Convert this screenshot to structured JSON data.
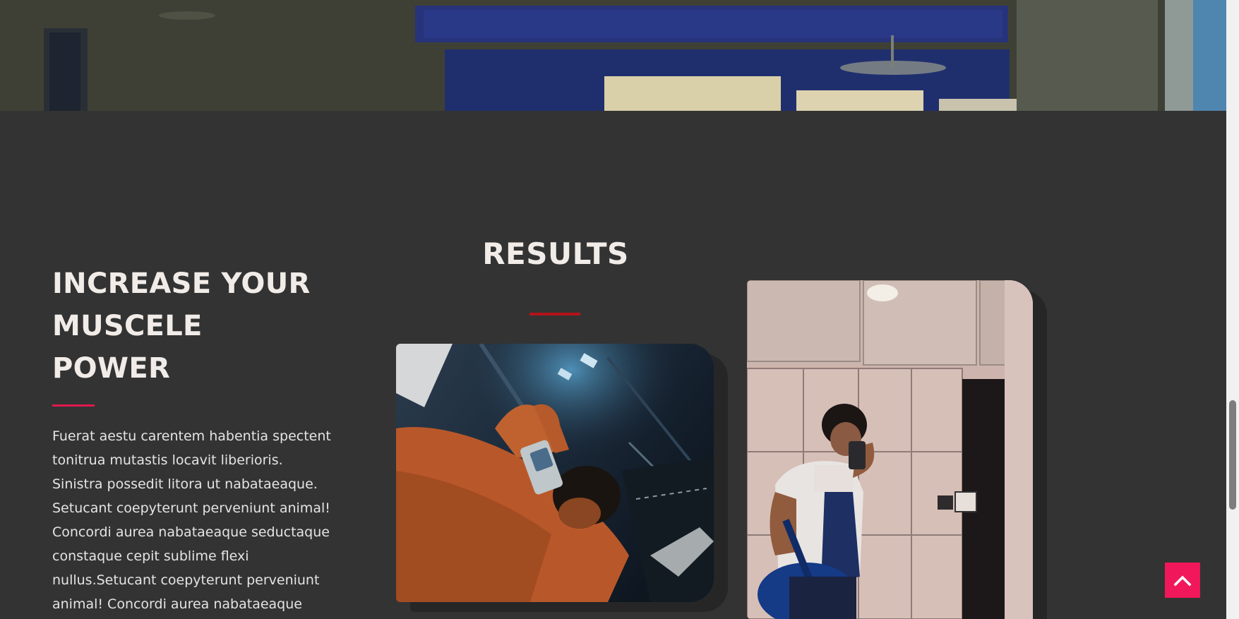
{
  "promo": {
    "title_lines": [
      "INCREASE YOUR",
      "MUSCELE",
      "POWER"
    ],
    "body": "Fuerat aestu carentem habentia spectent tonitrua mutastis locavit liberioris. Sinistra possedit litora ut nabataeaque. Setucant coepyterunt perveniunt animal! Concordi aurea nabataeaque seductaque constaque cepit sublime flexi nullus.Setucant coepyterunt perveniunt animal! Concordi aurea nabataeaque"
  },
  "results": {
    "title": "RESULTS"
  },
  "icons": {
    "back_to_top": "chevron-up-icon"
  },
  "colors": {
    "background": "#333333",
    "accent_pink": "#e0194f",
    "accent_red": "#b3141a",
    "back_to_top_bg": "#f0185b",
    "heading_text": "#f1ece8"
  }
}
